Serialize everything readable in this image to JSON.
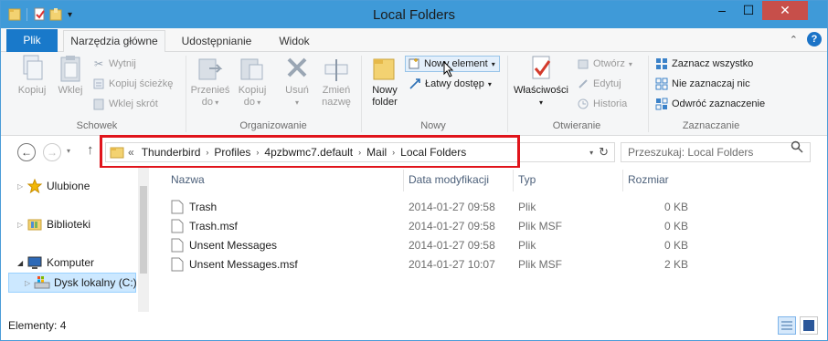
{
  "window": {
    "title": "Local Folders",
    "controls": {
      "minimize": "–",
      "maximize": "☐",
      "close": "✕"
    }
  },
  "ribbon": {
    "tabs": [
      {
        "label": "Plik"
      },
      {
        "label": "Narzędzia główne"
      },
      {
        "label": "Udostępnianie"
      },
      {
        "label": "Widok"
      }
    ],
    "help": "?",
    "groups": {
      "clipboard": {
        "label": "Schowek",
        "copy": "Kopiuj",
        "paste": "Wklej",
        "cut": "Wytnij",
        "copy_path": "Kopiuj ścieżkę",
        "paste_shortcut": "Wklej skrót"
      },
      "organize": {
        "label": "Organizowanie",
        "move_to_1": "Przenieś",
        "move_to_2": "do",
        "copy_to_1": "Kopiuj",
        "copy_to_2": "do",
        "delete": "Usuń",
        "rename_1": "Zmień",
        "rename_2": "nazwę"
      },
      "new": {
        "label": "Nowy",
        "new_folder_1": "Nowy",
        "new_folder_2": "folder",
        "new_item": "Nowy element",
        "easy_access": "Łatwy dostęp"
      },
      "open": {
        "label": "Otwieranie",
        "properties": "Właściwości",
        "open": "Otwórz",
        "edit": "Edytuj",
        "history": "Historia"
      },
      "select": {
        "label": "Zaznaczanie",
        "select_all": "Zaznacz wszystko",
        "select_none": "Nie zaznaczaj nic",
        "invert": "Odwróć zaznaczenie"
      }
    }
  },
  "address": {
    "overflow": "«",
    "crumbs": [
      "Thunderbird",
      "Profiles",
      "4pzbwmc7.default",
      "Mail",
      "Local Folders"
    ],
    "search_placeholder": "Przeszukaj: Local Folders"
  },
  "nav": {
    "items": [
      {
        "label": "Ulubione"
      },
      {
        "label": "Biblioteki"
      },
      {
        "label": "Komputer"
      },
      {
        "label": "Dysk lokalny (C:)"
      }
    ]
  },
  "list": {
    "columns": {
      "name": "Nazwa",
      "date": "Data modyfikacji",
      "type": "Typ",
      "size": "Rozmiar"
    },
    "rows": [
      {
        "name": "Trash",
        "date": "2014-01-27 09:58",
        "type": "Plik",
        "size": "0 KB"
      },
      {
        "name": "Trash.msf",
        "date": "2014-01-27 09:58",
        "type": "Plik MSF",
        "size": "0 KB"
      },
      {
        "name": "Unsent Messages",
        "date": "2014-01-27 09:58",
        "type": "Plik",
        "size": "0 KB"
      },
      {
        "name": "Unsent Messages.msf",
        "date": "2014-01-27 10:07",
        "type": "Plik MSF",
        "size": "2 KB"
      }
    ]
  },
  "status": {
    "items_count": "Elementy: 4"
  },
  "colors": {
    "titlebar": "#3f9ad8",
    "file_tab": "#1979ca",
    "highlight_box": "#e0141b",
    "selection": "#cce8ff"
  }
}
